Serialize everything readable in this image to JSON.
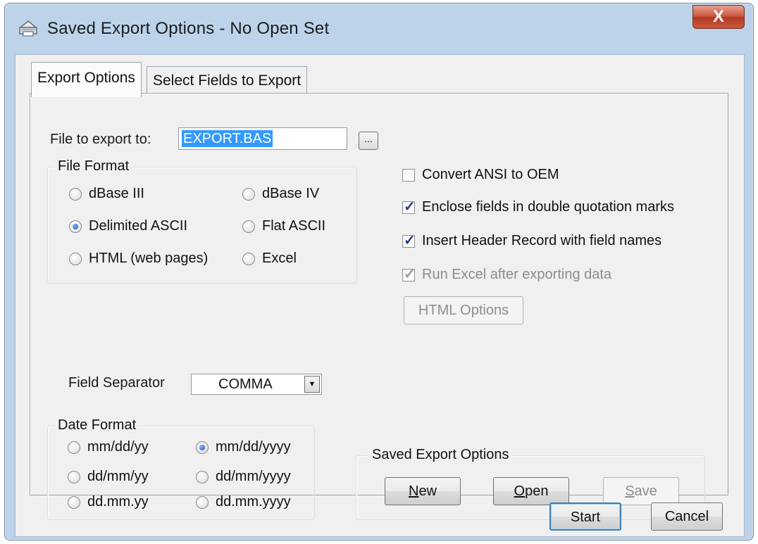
{
  "window": {
    "title": "Saved Export Options - No Open Set",
    "close_label": "X"
  },
  "tabs": [
    {
      "label": "Export Options",
      "active": true
    },
    {
      "label": "Select Fields to Export",
      "active": false
    }
  ],
  "file_export": {
    "label": "File to export to:",
    "value": "EXPORT.BAS",
    "browse_label": "..."
  },
  "file_format": {
    "title": "File Format",
    "options": [
      {
        "label": "dBase III",
        "selected": false
      },
      {
        "label": "dBase IV",
        "selected": false
      },
      {
        "label": "Delimited ASCII",
        "selected": true
      },
      {
        "label": "Flat ASCII",
        "selected": false
      },
      {
        "label": "HTML (web pages)",
        "selected": false
      },
      {
        "label": "Excel",
        "selected": false
      }
    ]
  },
  "options": [
    {
      "label": "Convert ANSI to OEM",
      "checked": false,
      "enabled": true
    },
    {
      "label": "Enclose fields in double quotation marks",
      "checked": true,
      "enabled": true
    },
    {
      "label": "Insert Header Record with field names",
      "checked": true,
      "enabled": true
    },
    {
      "label": "Run Excel after exporting data",
      "checked": true,
      "enabled": false
    }
  ],
  "html_options_label": "HTML Options",
  "field_separator": {
    "label": "Field Separator",
    "value": "COMMA"
  },
  "date_format": {
    "title": "Date Format",
    "options": [
      {
        "label": "mm/dd/yy",
        "selected": false
      },
      {
        "label": "mm/dd/yyyy",
        "selected": true
      },
      {
        "label": "dd/mm/yy",
        "selected": false
      },
      {
        "label": "dd/mm/yyyy",
        "selected": false
      },
      {
        "label": "dd.mm.yy",
        "selected": false
      },
      {
        "label": "dd.mm.yyyy",
        "selected": false
      }
    ]
  },
  "saved_export": {
    "title": "Saved Export Options",
    "new": {
      "mnemonic": "N",
      "rest": "ew"
    },
    "open": {
      "mnemonic": "O",
      "rest": "pen"
    },
    "save": {
      "mnemonic": "S",
      "rest": "ave",
      "enabled": false
    }
  },
  "footer": {
    "start_label": "Start",
    "cancel_label": "Cancel"
  }
}
